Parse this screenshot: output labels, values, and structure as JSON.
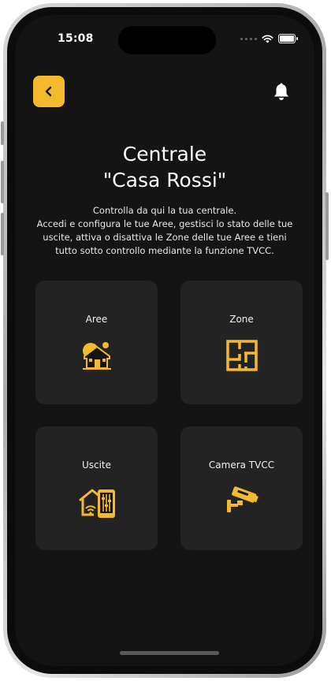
{
  "status_bar": {
    "time": "15:08"
  },
  "header": {
    "back_icon": "chevron-left-icon",
    "bell_icon": "bell-icon"
  },
  "title": {
    "line1": "Centrale",
    "line2": "\"Casa Rossi\""
  },
  "description": {
    "line1": "Controlla da qui la tua centrale.",
    "line2": "Accedi e configura le tue Aree, gestisci lo stato delle tue",
    "line3": "uscite, attiva o disattiva le Zone delle tue Aree e tieni",
    "line4": "tutto sotto controllo mediante la funzione TVCC."
  },
  "cards": [
    {
      "label": "Aree",
      "icon": "house-area-icon"
    },
    {
      "label": "Zone",
      "icon": "floor-plan-icon"
    },
    {
      "label": "Uscite",
      "icon": "smart-home-controls-icon"
    },
    {
      "label": "Camera TVCC",
      "icon": "cctv-camera-icon"
    }
  ],
  "colors": {
    "accent": "#F5B92E",
    "background": "#141414",
    "card": "#232323"
  }
}
